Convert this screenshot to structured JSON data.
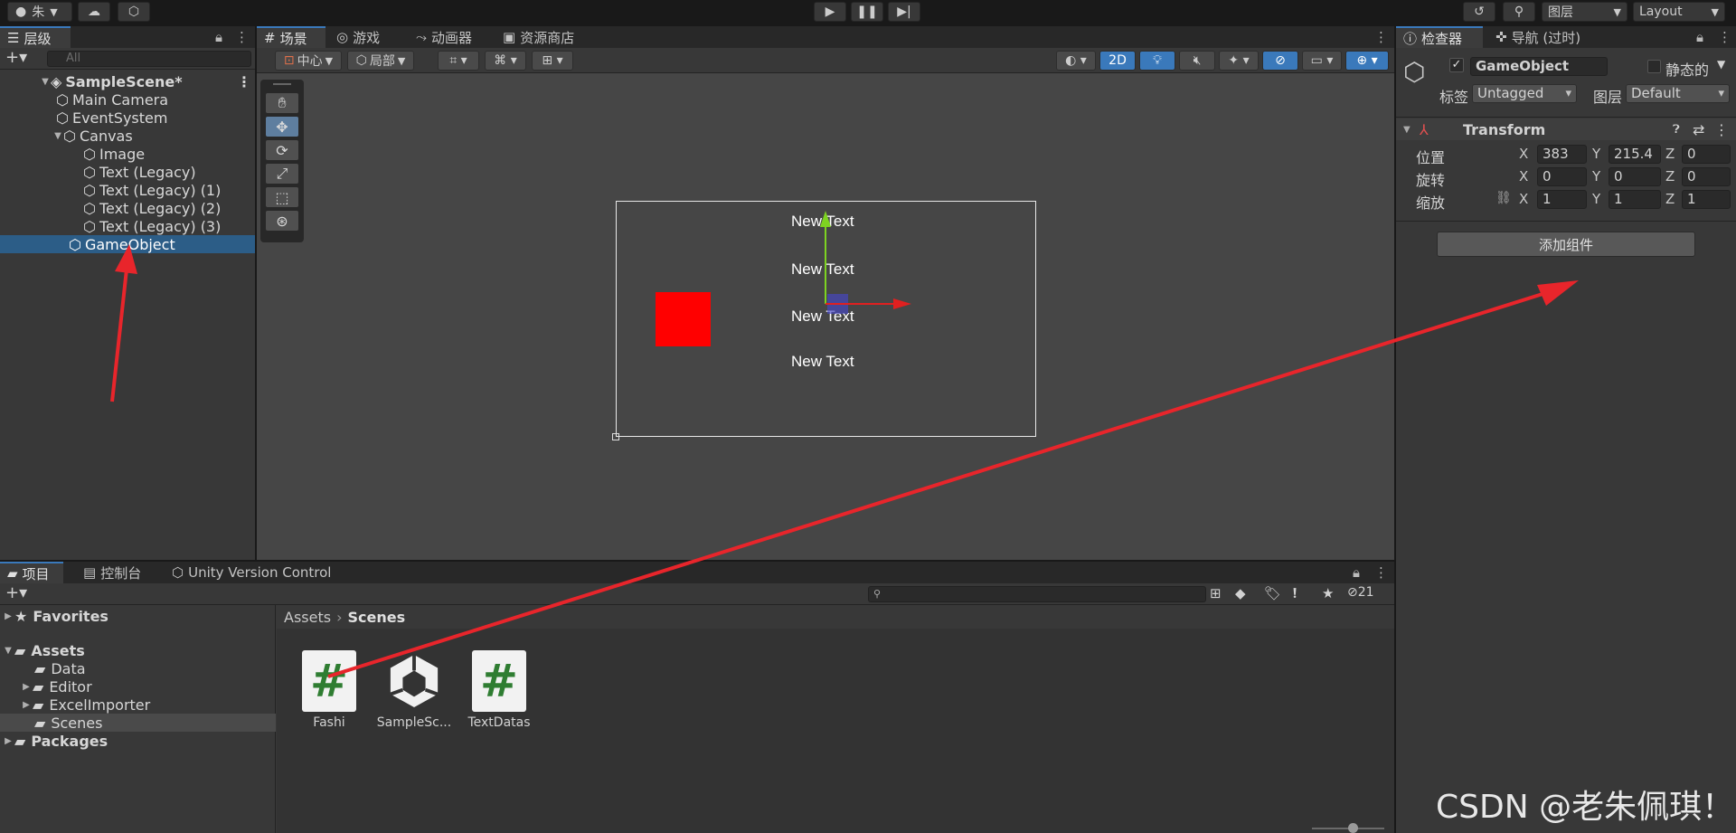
{
  "topbar": {
    "account_label": "朱",
    "layers_label": "图层",
    "layout_label": "Layout"
  },
  "hierarchy": {
    "tab_label": "层级",
    "search_placeholder": "All",
    "items": [
      {
        "label": "SampleScene*"
      },
      {
        "label": "Main Camera"
      },
      {
        "label": "EventSystem"
      },
      {
        "label": "Canvas"
      },
      {
        "label": "Image"
      },
      {
        "label": "Text (Legacy)"
      },
      {
        "label": "Text (Legacy) (1)"
      },
      {
        "label": "Text (Legacy) (2)"
      },
      {
        "label": "Text (Legacy) (3)"
      },
      {
        "label": "GameObject"
      }
    ]
  },
  "scene": {
    "tabs": [
      {
        "label": "场景"
      },
      {
        "label": "游戏"
      },
      {
        "label": "动画器"
      },
      {
        "label": "资源商店"
      }
    ],
    "pivot_label": "中心",
    "space_label": "局部",
    "mode_2d_label": "2D",
    "texts": [
      "New Text",
      "New Text",
      "New Text",
      "New Text"
    ]
  },
  "inspector": {
    "tabs": [
      {
        "label": "检查器"
      },
      {
        "label": "导航 (过时)"
      }
    ],
    "object_name": "GameObject",
    "static_label": "静态的",
    "tag_label": "标签",
    "tag_value": "Untagged",
    "layer_label": "图层",
    "layer_value": "Default",
    "transform_title": "Transform",
    "rows": [
      {
        "label": "位置",
        "x": "383",
        "y": "215.4",
        "z": "0"
      },
      {
        "label": "旋转",
        "x": "0",
        "y": "0",
        "z": "0"
      },
      {
        "label": "缩放",
        "x": "1",
        "y": "1",
        "z": "1"
      }
    ],
    "axis_x": "X",
    "axis_y": "Y",
    "axis_z": "Z",
    "add_component_label": "添加组件",
    "watermark": "CSDN @老朱佩琪！"
  },
  "project": {
    "tabs": [
      {
        "label": "项目"
      },
      {
        "label": "控制台"
      },
      {
        "label": "Unity Version Control"
      }
    ],
    "hidden_count": "21",
    "tree": [
      {
        "label": "Favorites"
      },
      {
        "label": "Assets"
      },
      {
        "label": "Data"
      },
      {
        "label": "Editor"
      },
      {
        "label": "ExcelImporter"
      },
      {
        "label": "Scenes"
      },
      {
        "label": "Packages"
      }
    ],
    "breadcrumb": [
      "Assets",
      "Scenes"
    ],
    "assets": [
      {
        "label": "Fashi",
        "icon": "csharp-script-icon"
      },
      {
        "label": "SampleSc...",
        "icon": "unity-scene-icon"
      },
      {
        "label": "TextDatas",
        "icon": "csharp-script-icon"
      }
    ]
  },
  "colors": {
    "accent": "#3a79bb",
    "selection": "#2c5d87",
    "annotation_arrow": "#e8252b",
    "gizmo_y": "#7ed321",
    "gizmo_x": "#e02020"
  }
}
